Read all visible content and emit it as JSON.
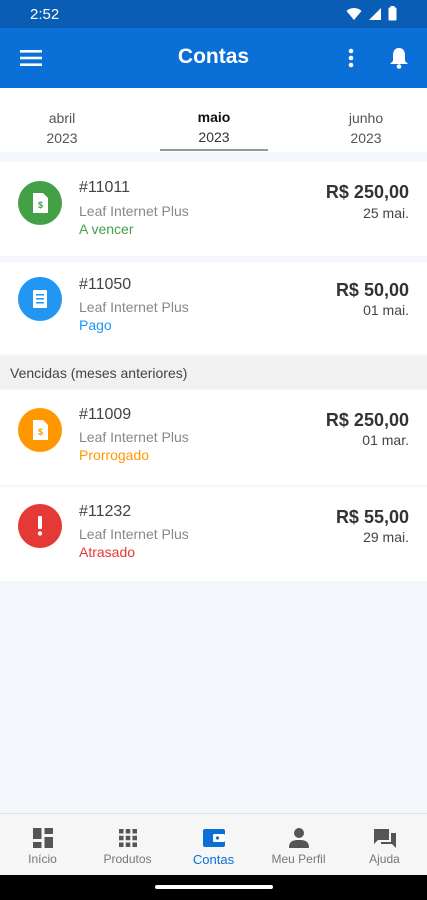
{
  "status_bar": {
    "time": "2:52"
  },
  "app_bar": {
    "title": "Contas"
  },
  "months": [
    {
      "month": "abril",
      "year": "2023",
      "active": false
    },
    {
      "month": "maio",
      "year": "2023",
      "active": true
    },
    {
      "month": "junho",
      "year": "2023",
      "active": false
    }
  ],
  "current_bills": [
    {
      "id": "#11011",
      "plan": "Leaf Internet Plus",
      "status": "A vencer",
      "amount": "R$ 250,00",
      "date": "25 mai.",
      "color": "#43a047",
      "icon": "invoice-dollar-icon"
    },
    {
      "id": "#11050",
      "plan": "Leaf Internet Plus",
      "status": "Pago",
      "amount": "R$ 50,00",
      "date": "01 mai.",
      "color": "#2196f3",
      "icon": "receipt-icon"
    }
  ],
  "overdue_section": {
    "label": "Vencidas (meses anteriores)"
  },
  "overdue_bills": [
    {
      "id": "#11009",
      "plan": "Leaf Internet Plus",
      "status": "Prorrogado",
      "amount": "R$ 250,00",
      "date": "01 mar.",
      "color": "#ff9800",
      "icon": "invoice-dollar-icon"
    },
    {
      "id": "#11232",
      "plan": "Leaf Internet Plus",
      "status": "Atrasado",
      "amount": "R$ 55,00",
      "date": "29 mai.",
      "color": "#e53935",
      "icon": "exclamation-icon"
    }
  ],
  "bottom_nav": [
    {
      "label": "Início",
      "icon": "dashboard-icon",
      "active": false
    },
    {
      "label": "Produtos",
      "icon": "grid-icon",
      "active": false
    },
    {
      "label": "Contas",
      "icon": "wallet-icon",
      "active": true
    },
    {
      "label": "Meu Perfil",
      "icon": "person-icon",
      "active": false
    },
    {
      "label": "Ajuda",
      "icon": "chat-icon",
      "active": false
    }
  ],
  "colors": {
    "primary": "#0a6fd6",
    "status_bar": "#0a5db5"
  }
}
